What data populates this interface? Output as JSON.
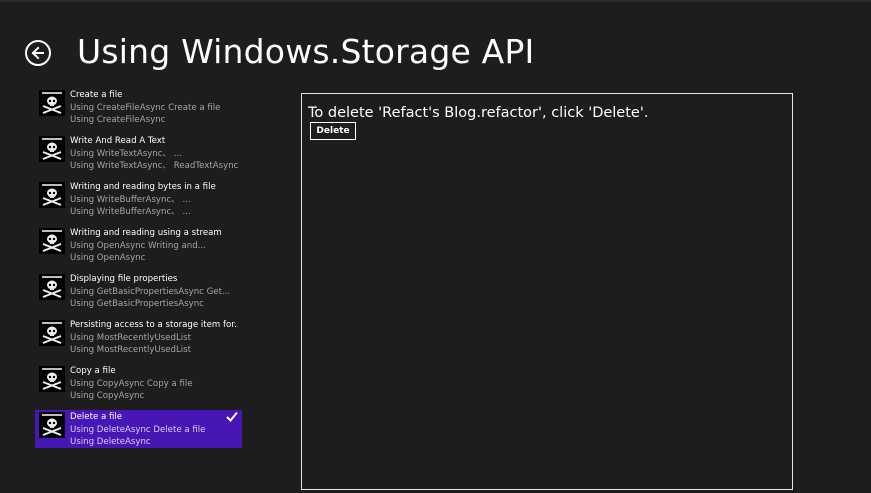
{
  "header": {
    "title": "Using Windows.Storage API",
    "back_icon": "back-arrow-icon"
  },
  "scenarios": [
    {
      "title": "Create a file",
      "line1": "Using CreateFileAsync Create a file",
      "line2": "Using CreateFileAsync",
      "selected": false
    },
    {
      "title": "Write And Read A Text",
      "line1": "Using WriteTextAsync、 ...",
      "line2": "Using WriteTextAsync、 ReadTextAsync",
      "selected": false
    },
    {
      "title": "Writing and reading bytes in a file",
      "line1": "Using WriteBufferAsync、 ...",
      "line2": "Using WriteBufferAsync、 ...",
      "selected": false
    },
    {
      "title": "Writing and reading using a stream",
      "line1": "Using OpenAsync Writing and...",
      "line2": "Using OpenAsync",
      "selected": false
    },
    {
      "title": "Displaying file properties",
      "line1": "Using GetBasicPropertiesAsync  Get...",
      "line2": "Using GetBasicPropertiesAsync",
      "selected": false
    },
    {
      "title": "Persisting access to a storage item for...",
      "line1": "Using MostRecentlyUsedList",
      "line2": "Using MostRecentlyUsedList",
      "selected": false
    },
    {
      "title": "Copy a file",
      "line1": "Using CopyAsync Copy a file",
      "line2": "Using CopyAsync",
      "selected": false
    },
    {
      "title": "Delete a file",
      "line1": "Using DeleteAsync Delete a file",
      "line2": "Using DeleteAsync",
      "selected": true
    }
  ],
  "output": {
    "message": "To delete 'Refact's Blog.refactor', click 'Delete'.",
    "delete_label": "Delete"
  },
  "colors": {
    "background": "#1d1d1d",
    "selected": "#4617b4",
    "subtext": "#a6a6a6"
  }
}
